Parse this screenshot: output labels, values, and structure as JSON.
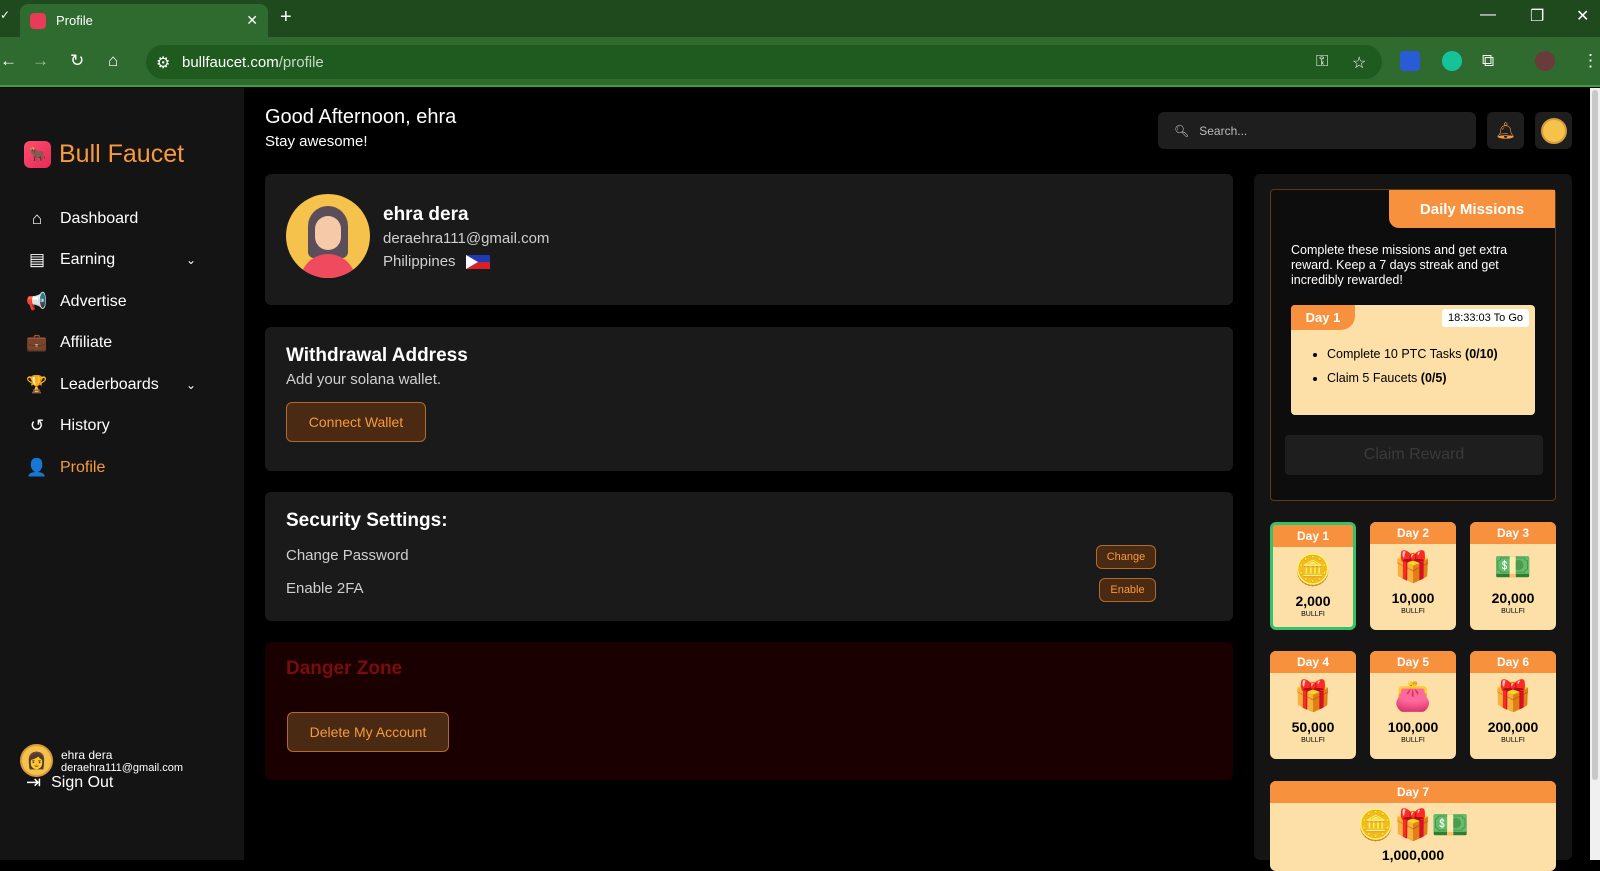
{
  "browser": {
    "tab_title": "Profile",
    "url_host": "bullfaucet.com",
    "url_path": "/profile"
  },
  "brand": {
    "name": "Bull Faucet"
  },
  "nav": [
    {
      "label": "Dashboard",
      "icon": "home-icon",
      "dropdown": false,
      "active": false
    },
    {
      "label": "Earning",
      "icon": "money-icon",
      "dropdown": true,
      "active": false
    },
    {
      "label": "Advertise",
      "icon": "megaphone-icon",
      "dropdown": false,
      "active": false
    },
    {
      "label": "Affiliate",
      "icon": "briefcase-icon",
      "dropdown": false,
      "active": false
    },
    {
      "label": "Leaderboards",
      "icon": "trophy-icon",
      "dropdown": true,
      "active": false
    },
    {
      "label": "History",
      "icon": "history-icon",
      "dropdown": false,
      "active": false
    },
    {
      "label": "Profile",
      "icon": "user-icon",
      "dropdown": false,
      "active": true
    }
  ],
  "sidebar_user": {
    "name": "ehra dera",
    "email": "deraehra111@gmail.com"
  },
  "sign_out": "Sign Out",
  "header": {
    "greeting": "Good Afternoon, ehra",
    "subgreeting": "Stay awesome!",
    "search_placeholder": "Search..."
  },
  "profile": {
    "name": "ehra dera",
    "email": "deraehra111@gmail.com",
    "country": "Philippines"
  },
  "wallet": {
    "title": "Withdrawal Address",
    "subtitle": "Add your solana wallet.",
    "button": "Connect Wallet"
  },
  "security": {
    "title": "Security Settings:",
    "rows": [
      {
        "label": "Change Password",
        "button": "Change"
      },
      {
        "label": "Enable 2FA",
        "button": "Enable"
      }
    ]
  },
  "danger": {
    "title": "Danger Zone",
    "button": "Delete My Account"
  },
  "missions": {
    "badge": "Daily Missions",
    "description": "Complete these missions and get extra reward. Keep a 7 days streak and get incredibly rewarded!",
    "day_tag": "Day 1",
    "timer": "18:33:03 To Go",
    "tasks": [
      {
        "text": "Complete 10 PTC Tasks",
        "progress": "(0/10)"
      },
      {
        "text": "Claim 5 Faucets",
        "progress": "(0/5)"
      }
    ],
    "claim_button": "Claim Reward"
  },
  "streak": [
    {
      "day": "Day 1",
      "amount": "2,000",
      "unit": "BULLFI",
      "icon": "coins-icon"
    },
    {
      "day": "Day 2",
      "amount": "10,000",
      "unit": "BULLFI",
      "icon": "gift-icon"
    },
    {
      "day": "Day 3",
      "amount": "20,000",
      "unit": "BULLFI",
      "icon": "cash-icon"
    },
    {
      "day": "Day 4",
      "amount": "50,000",
      "unit": "BULLFI",
      "icon": "gift-icon"
    },
    {
      "day": "Day 5",
      "amount": "100,000",
      "unit": "BULLFI",
      "icon": "wallet-icon"
    },
    {
      "day": "Day 6",
      "amount": "200,000",
      "unit": "BULLFI",
      "icon": "gift-icon"
    }
  ],
  "day7": {
    "day": "Day 7",
    "amount": "1,000,000"
  },
  "colors": {
    "accent": "#f79a3e",
    "selected": "#33c26a",
    "chrome": "#2f6b2f"
  }
}
